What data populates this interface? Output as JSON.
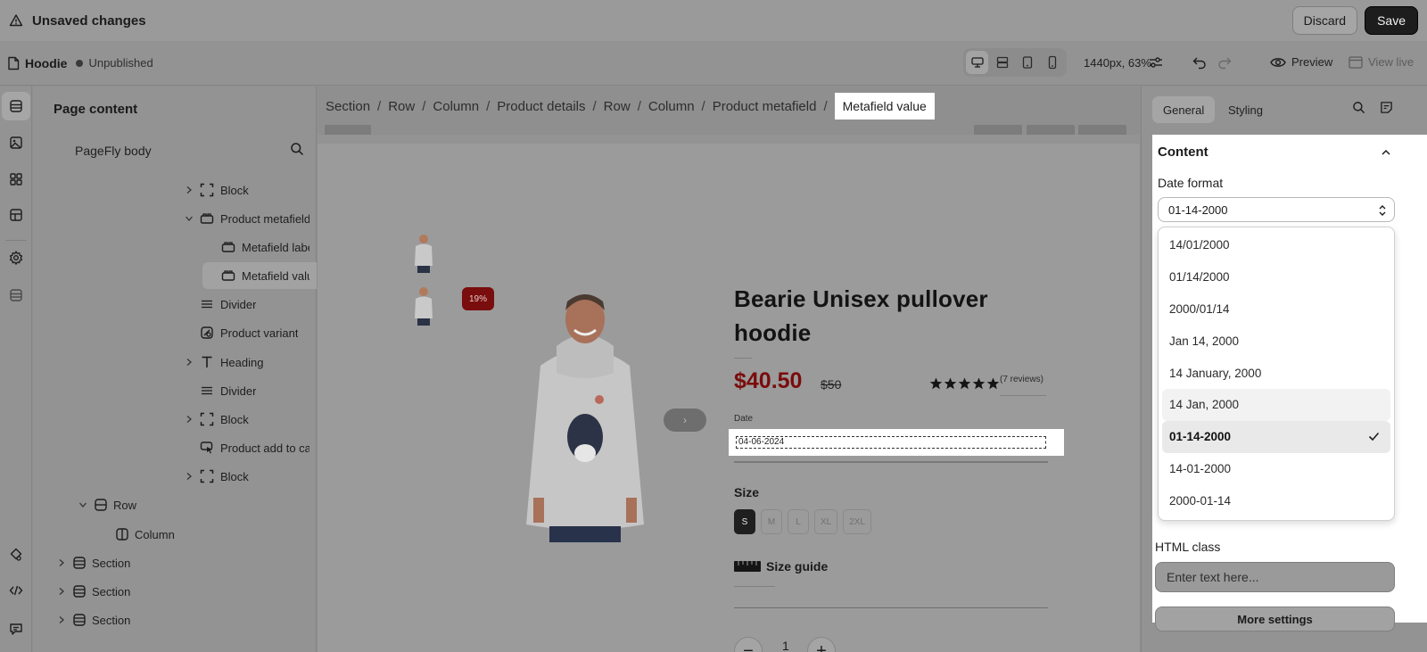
{
  "topbar": {
    "title": "Unsaved changes",
    "discard_label": "Discard",
    "save_label": "Save"
  },
  "toolbar": {
    "page_name": "Hoodie",
    "page_status": "Unpublished",
    "zoom": "1440px, 63%",
    "preview_label": "Preview",
    "view_live_label": "View live"
  },
  "layers": {
    "title": "Page content",
    "body_title": "PageFly body",
    "items": [
      {
        "label": "Block"
      },
      {
        "label": "Product metafield"
      },
      {
        "label": "Metafield label"
      },
      {
        "label": "Metafield value"
      },
      {
        "label": "Divider"
      },
      {
        "label": "Product variant"
      },
      {
        "label": "Heading"
      },
      {
        "label": "Divider"
      },
      {
        "label": "Block"
      },
      {
        "label": "Product add to cart"
      },
      {
        "label": "Block"
      },
      {
        "label": "Row"
      },
      {
        "label": "Column"
      },
      {
        "label": "Section"
      },
      {
        "label": "Section"
      },
      {
        "label": "Section"
      }
    ]
  },
  "breadcrumb": {
    "items": [
      "Section",
      "Row",
      "Column",
      "Product details",
      "Row",
      "Column",
      "Product metafield"
    ],
    "separator": "/",
    "current": "Metafield value"
  },
  "product": {
    "sale_badge": "19%",
    "title": "Bearie Unisex pullover hoodie",
    "price": "$40.50",
    "compare_price": "$50",
    "reviews": "(7 reviews)",
    "rating": 5,
    "date_label": "Date",
    "date_value": "04-06-2024",
    "size_title": "Size",
    "sizes": [
      "S",
      "M",
      "L",
      "XL",
      "2XL"
    ],
    "selected_size": "S",
    "size_guide_label": "Size guide",
    "quantity": "1",
    "minus": "−",
    "plus": "+",
    "next_arrow": "›"
  },
  "right_panel": {
    "tabs": [
      "General",
      "Styling"
    ],
    "active_tab": "General",
    "content_title": "Content",
    "date_format_label": "Date format",
    "date_format_value": "01-14-2000",
    "date_format_options": [
      "14/01/2000",
      "01/14/2000",
      "2000/01/14",
      "Jan 14, 2000",
      "14 January, 2000",
      "14 Jan, 2000",
      "01-14-2000",
      "14-01-2000",
      "2000-01-14"
    ],
    "hovered_option": "14 Jan, 2000",
    "html_class_label": "HTML class",
    "html_class_placeholder": "Enter text here...",
    "more_settings_label": "More settings"
  },
  "colors": {
    "price": "#7a0c0c",
    "sale_badge": "#7a0d0d",
    "save_button": "#1d1d1d"
  }
}
